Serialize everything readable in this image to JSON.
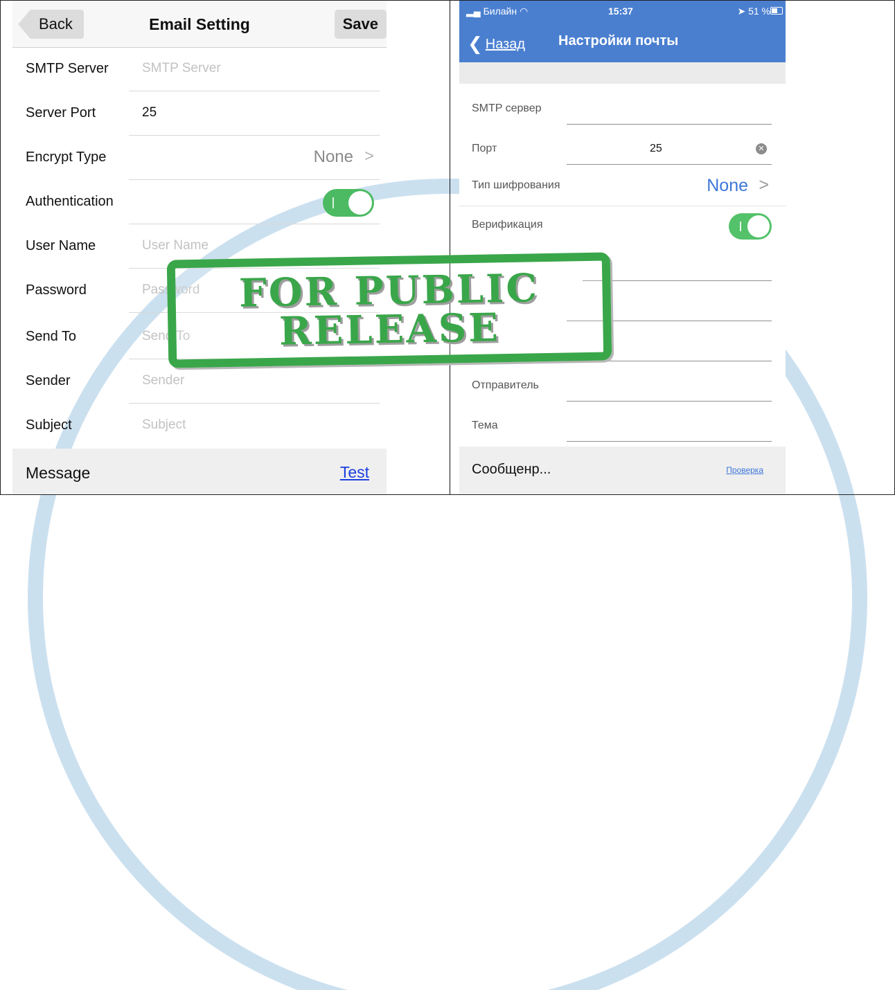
{
  "left": {
    "nav": {
      "back": "Back",
      "title": "Email Setting",
      "save": "Save"
    },
    "rows": [
      {
        "label": "SMTP Server",
        "value": "",
        "placeholder": "SMTP Server"
      },
      {
        "label": "Server Port",
        "value": "25",
        "placeholder": ""
      },
      {
        "label": "Encrypt Type",
        "selected": "None"
      },
      {
        "label": "Authentication",
        "toggle_on": true
      },
      {
        "label": "User Name",
        "value": "",
        "placeholder": "User Name"
      },
      {
        "label": "Password",
        "value": "",
        "placeholder": "Password"
      },
      {
        "label": "Send To",
        "value": "",
        "placeholder": "Send To"
      },
      {
        "label": "Sender",
        "value": "",
        "placeholder": "Sender"
      },
      {
        "label": "Subject",
        "value": "",
        "placeholder": "Subject"
      }
    ],
    "message": {
      "label": "Message",
      "test": "Test"
    }
  },
  "right": {
    "status": {
      "carrier": "Билайн",
      "time": "15:37",
      "battery": "51 %"
    },
    "nav": {
      "back": "Назад",
      "title": "Настройки почты"
    },
    "rows": [
      {
        "label": "SMTP сервер",
        "value": ""
      },
      {
        "label": "Порт",
        "value": "25"
      },
      {
        "label": "Тип шифрования",
        "selected": "None"
      },
      {
        "label": "Верификация",
        "toggle_on": true
      },
      {
        "label": "Отправитель",
        "value": ""
      },
      {
        "label": "Тема",
        "value": ""
      }
    ],
    "message": {
      "label": "Сообщенр...",
      "check": "Проверка"
    }
  },
  "stamp": {
    "line1": "FOR PUBLIC",
    "line2": "RELEASE"
  },
  "colors": {
    "toggle_green": "#4cba62",
    "nav_blue": "#4a7fd0",
    "link_blue": "#1a3fe0",
    "stamp_green": "#3aa64a"
  }
}
